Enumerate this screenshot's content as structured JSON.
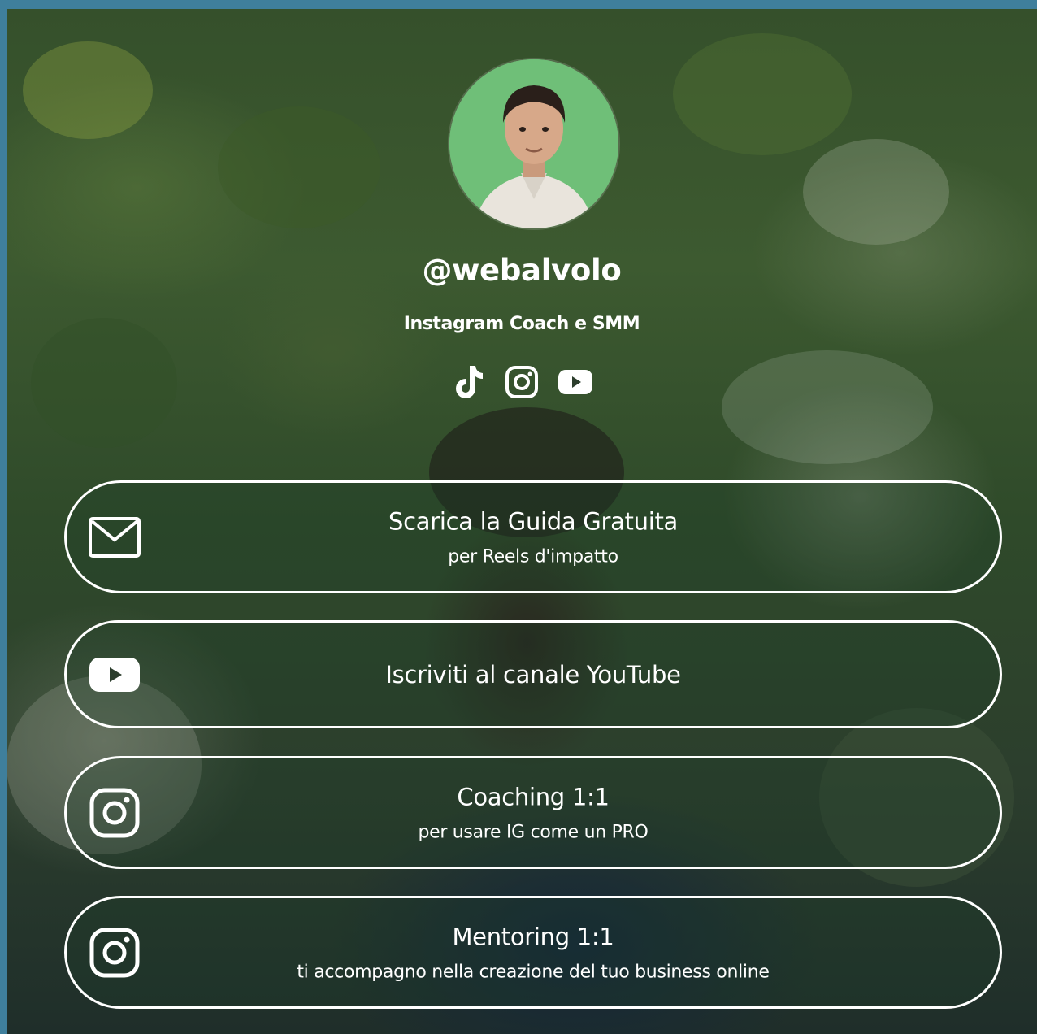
{
  "profile": {
    "handle": "@webalvolo",
    "bio": "Instagram Coach e SMM",
    "avatar_bg": "#6fbf78"
  },
  "socials": [
    {
      "icon": "tiktok-icon"
    },
    {
      "icon": "instagram-icon"
    },
    {
      "icon": "youtube-icon"
    }
  ],
  "links": [
    {
      "title": "Scarica la Guida Gratuita",
      "subtitle": "per Reels d'impatto",
      "icon": "mail-icon"
    },
    {
      "title": "Iscriviti al canale YouTube",
      "subtitle": "",
      "icon": "youtube-icon"
    },
    {
      "title": "Coaching 1:1",
      "subtitle": "per usare IG come un PRO",
      "icon": "instagram-icon"
    },
    {
      "title": "Mentoring 1:1",
      "subtitle": "ti accompagno nella creazione del tuo business online",
      "icon": "instagram-icon"
    }
  ],
  "colors": {
    "page_border": "#3f7f9c",
    "button_border": "#ffffff",
    "text": "#ffffff"
  }
}
